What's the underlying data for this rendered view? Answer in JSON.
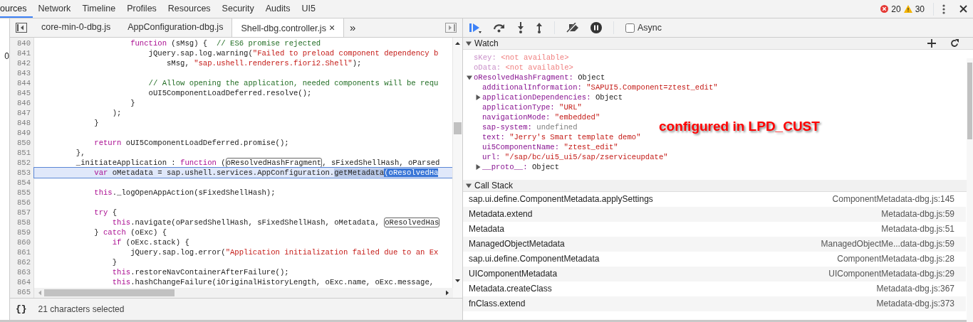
{
  "main_tabs": [
    {
      "label": "ources",
      "selected": true
    },
    {
      "label": "Network",
      "selected": false
    },
    {
      "label": "Timeline",
      "selected": false
    },
    {
      "label": "Profiles",
      "selected": false
    },
    {
      "label": "Resources",
      "selected": false
    },
    {
      "label": "Security",
      "selected": false
    },
    {
      "label": "Audits",
      "selected": false
    },
    {
      "label": "UI5",
      "selected": false
    }
  ],
  "counters": {
    "errors": "20",
    "warnings": "30"
  },
  "navigator_text": "0",
  "file_tabs": [
    {
      "label": "core-min-0-dbg.js",
      "selected": false
    },
    {
      "label": "AppConfiguration-dbg.js",
      "selected": false
    },
    {
      "label": "Shell-dbg.controller.js",
      "selected": true
    }
  ],
  "more_tabs": "»",
  "close_mark": "×",
  "code_lines": [
    {
      "number": "840",
      "selected": false,
      "tokens": [
        {
          "kind": "keyword",
          "text": "                    function"
        },
        {
          "kind": "plain",
          "text": " (sMsg) {  "
        },
        {
          "kind": "comment",
          "text": "// ES6 promise rejected"
        }
      ]
    },
    {
      "number": "841",
      "selected": false,
      "tokens": [
        {
          "kind": "plain",
          "text": "                        jQuery.sap.log.warning("
        },
        {
          "kind": "string",
          "text": "\"Failed to preload component dependency b"
        }
      ]
    },
    {
      "number": "842",
      "selected": false,
      "tokens": [
        {
          "kind": "plain",
          "text": "                            sMsg, "
        },
        {
          "kind": "string",
          "text": "\"sap.ushell.renderers.fiori2.Shell\""
        },
        {
          "kind": "plain",
          "text": ");"
        }
      ]
    },
    {
      "number": "843",
      "selected": false
    },
    {
      "number": "844",
      "selected": false,
      "tokens": [
        {
          "kind": "comment",
          "text": "                        // Allow opening the application, needed components will be requ"
        }
      ]
    },
    {
      "number": "845",
      "selected": false,
      "tokens": [
        {
          "kind": "plain",
          "text": "                        oUI5ComponentLoadDeferred.resolve();"
        }
      ]
    },
    {
      "number": "846",
      "selected": false,
      "tokens": [
        {
          "kind": "plain",
          "text": "                    }"
        }
      ]
    },
    {
      "number": "847",
      "selected": false,
      "tokens": [
        {
          "kind": "plain",
          "text": "                );"
        }
      ]
    },
    {
      "number": "848",
      "selected": false,
      "tokens": [
        {
          "kind": "plain",
          "text": "            }"
        }
      ]
    },
    {
      "number": "849",
      "selected": false
    },
    {
      "number": "850",
      "selected": false,
      "tokens": [
        {
          "kind": "keyword",
          "text": "            return"
        },
        {
          "kind": "plain",
          "text": " oUI5ComponentLoadDeferred.promise();"
        }
      ]
    },
    {
      "number": "851",
      "selected": false,
      "tokens": [
        {
          "kind": "plain",
          "text": "        },"
        }
      ]
    },
    {
      "number": "852",
      "selected": false,
      "tokens": [
        {
          "kind": "plain",
          "text": "        _initiateApplication : "
        },
        {
          "kind": "keyword",
          "text": "function"
        },
        {
          "kind": "plain",
          "text": " ("
        },
        {
          "kind": "boxed",
          "text": "oResolvedHashFragment"
        },
        {
          "kind": "plain",
          "text": ", sFixedShellHash, oParsed"
        }
      ]
    },
    {
      "number": "853",
      "selected": true,
      "tokens": [
        {
          "kind": "keyword",
          "text": "            var"
        },
        {
          "kind": "plain",
          "text": " oMetadata = sap.ushell.services.AppConfiguration."
        },
        {
          "kind": "match",
          "text": "getMetadata"
        },
        {
          "kind": "selection",
          "text": "(oResolvedHa"
        }
      ]
    },
    {
      "number": "854",
      "selected": false
    },
    {
      "number": "855",
      "selected": false,
      "tokens": [
        {
          "kind": "keyword",
          "text": "            this"
        },
        {
          "kind": "plain",
          "text": "._logOpenAppAction(sFixedShellHash);"
        }
      ]
    },
    {
      "number": "856",
      "selected": false
    },
    {
      "number": "857",
      "selected": false,
      "tokens": [
        {
          "kind": "keyword",
          "text": "            try"
        },
        {
          "kind": "plain",
          "text": " {"
        }
      ]
    },
    {
      "number": "858",
      "selected": false,
      "tokens": [
        {
          "kind": "keyword",
          "text": "                this"
        },
        {
          "kind": "plain",
          "text": ".navigate(oParsedShellHash, sFixedShellHash, oMetadata, "
        },
        {
          "kind": "boxed",
          "text": "oResolvedHas"
        }
      ]
    },
    {
      "number": "859",
      "selected": false,
      "tokens": [
        {
          "kind": "plain",
          "text": "            } "
        },
        {
          "kind": "keyword",
          "text": "catch"
        },
        {
          "kind": "plain",
          "text": " (oExc) {"
        }
      ]
    },
    {
      "number": "860",
      "selected": false,
      "tokens": [
        {
          "kind": "keyword",
          "text": "                if"
        },
        {
          "kind": "plain",
          "text": " (oExc.stack) {"
        }
      ]
    },
    {
      "number": "861",
      "selected": false,
      "tokens": [
        {
          "kind": "plain",
          "text": "                    jQuery.sap.log.error("
        },
        {
          "kind": "string",
          "text": "\"Application initialization failed due to an Ex"
        }
      ]
    },
    {
      "number": "862",
      "selected": false,
      "tokens": [
        {
          "kind": "plain",
          "text": "                }"
        }
      ]
    },
    {
      "number": "863",
      "selected": false,
      "tokens": [
        {
          "kind": "keyword",
          "text": "                this"
        },
        {
          "kind": "plain",
          "text": ".restoreNavContainerAfterFailure();"
        }
      ]
    },
    {
      "number": "864",
      "selected": false,
      "tokens": [
        {
          "kind": "keyword",
          "text": "                this"
        },
        {
          "kind": "plain",
          "text": ".hashChangeFailure(iOriginalHistoryLength, oExc.name, oExc.message,"
        }
      ]
    },
    {
      "number": "865",
      "selected": false
    }
  ],
  "status_bar": {
    "format_mark": "{}",
    "text": "21 characters selected"
  },
  "async_checkbox": {
    "label": "Async",
    "checked": false
  },
  "watch": {
    "title": "Watch",
    "expanded": true,
    "items": [
      {
        "name": "sKey:",
        "value": "<not available>",
        "kind": "unavailable"
      },
      {
        "name": "oData:",
        "value": "<not available>",
        "kind": "unavailable"
      },
      {
        "name": "oResolvedHashFragment:",
        "value": "Object",
        "kind": "object",
        "expanded": true,
        "children": [
          {
            "name": "additionalInformation:",
            "value": "\"SAPUI5.Component=ztest_edit\"",
            "kind": "string"
          },
          {
            "name": "applicationDependencies:",
            "value": "Object",
            "kind": "object",
            "expanded": false
          },
          {
            "name": "applicationType:",
            "value": "\"URL\"",
            "kind": "string"
          },
          {
            "name": "navigationMode:",
            "value": "\"embedded\"",
            "kind": "string"
          },
          {
            "name": "sap-system:",
            "value": "undefined",
            "kind": "undefined"
          },
          {
            "name": "text:",
            "value": "\"Jerry's Smart template demo\"",
            "kind": "string"
          },
          {
            "name": "ui5ComponentName:",
            "value": "\"ztest_edit\"",
            "kind": "string"
          },
          {
            "name": "url:",
            "value": "\"/sap/bc/ui5_ui5/sap/zserviceupdate\"",
            "kind": "string"
          },
          {
            "name": "__proto__:",
            "value": "Object",
            "kind": "object",
            "expanded": false
          }
        ]
      }
    ]
  },
  "annotation": "configured in LPD_CUST",
  "call_stack": {
    "title": "Call Stack",
    "expanded": true,
    "frames": [
      {
        "function": "sap.ui.define.ComponentMetadata.applySettings",
        "location": "ComponentMetadata-dbg.js:145"
      },
      {
        "function": "Metadata.extend",
        "location": "Metadata-dbg.js:59"
      },
      {
        "function": "Metadata",
        "location": "Metadata-dbg.js:51"
      },
      {
        "function": "ManagedObjectMetadata",
        "location": "ManagedObjectMe...data-dbg.js:59"
      },
      {
        "function": "sap.ui.define.ComponentMetadata",
        "location": "ComponentMetadata-dbg.js:28"
      },
      {
        "function": "UIComponentMetadata",
        "location": "UIComponentMetadata-dbg.js:29"
      },
      {
        "function": "Metadata.createClass",
        "location": "Metadata-dbg.js:367"
      },
      {
        "function": "fnClass.extend",
        "location": "Metadata-dbg.js:373"
      }
    ]
  }
}
